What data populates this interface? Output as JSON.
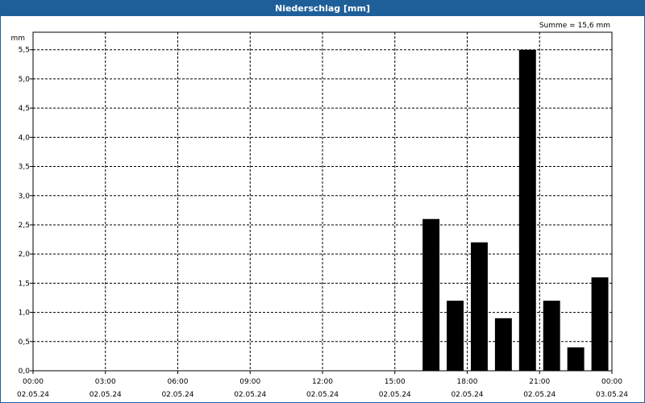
{
  "window": {
    "title": "Niederschlag [mm]"
  },
  "chart_data": {
    "type": "bar",
    "title": "Niederschlag [mm]",
    "ylabel": "mm",
    "annotation": "Summe = 15,6 mm",
    "ylim": [
      0,
      5.8
    ],
    "y_ticks": [
      "0,0",
      "0,5",
      "1,0",
      "1,5",
      "2,0",
      "2,5",
      "3,0",
      "3,5",
      "4,0",
      "4,5",
      "5,0",
      "5,5"
    ],
    "xlim": [
      "02.05.24 00:00",
      "03.05.24 00:00"
    ],
    "x_ticks": [
      {
        "time": "00:00",
        "date": "02.05.24"
      },
      {
        "time": "03:00",
        "date": "02.05.24"
      },
      {
        "time": "06:00",
        "date": "02.05.24"
      },
      {
        "time": "09:00",
        "date": "02.05.24"
      },
      {
        "time": "12:00",
        "date": "02.05.24"
      },
      {
        "time": "15:00",
        "date": "02.05.24"
      },
      {
        "time": "18:00",
        "date": "02.05.24"
      },
      {
        "time": "21:00",
        "date": "02.05.24"
      },
      {
        "time": "00:00",
        "date": "03.05.24"
      }
    ],
    "grid": true,
    "bar_color": "#000000",
    "categories": [
      "17:00",
      "18:00",
      "19:00",
      "20:00",
      "21:00",
      "22:00",
      "23:00",
      "00:00"
    ],
    "values": [
      2.6,
      1.2,
      2.2,
      0.9,
      5.5,
      1.2,
      0.4,
      1.6
    ]
  }
}
